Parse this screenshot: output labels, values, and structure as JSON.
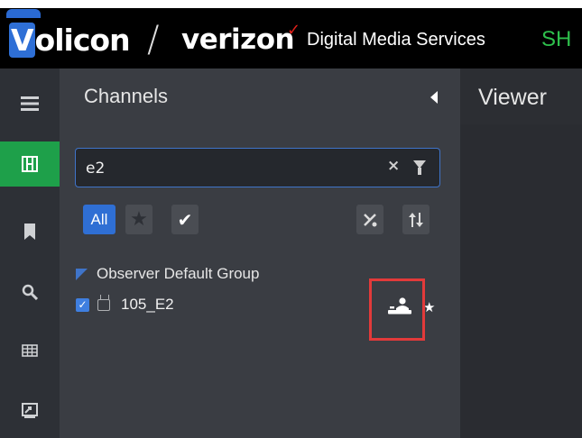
{
  "header": {
    "brand_volicon_first": "V",
    "brand_volicon_rest": "olicon",
    "brand_slash": "/",
    "brand_verizon": "verizon",
    "brand_check": "✓",
    "brand_service": "Digital Media Services",
    "brand_cutoff": "SH"
  },
  "sidebar": {
    "items": [
      {
        "icon": "menu-icon"
      },
      {
        "icon": "channels-grid-icon",
        "active": true
      },
      {
        "icon": "bookmark-icon"
      },
      {
        "icon": "search-icon"
      },
      {
        "icon": "table-icon"
      },
      {
        "icon": "export-icon"
      }
    ]
  },
  "channels_panel": {
    "title": "Channels",
    "search_value": "e2",
    "filters": {
      "all_label": "All"
    },
    "group_name": "Observer Default Group",
    "channels": [
      {
        "name": "105_E2",
        "checked": true
      }
    ]
  },
  "viewer": {
    "title": "Viewer"
  },
  "colors": {
    "accent_blue": "#2f6fd4",
    "active_green": "#1ea04a",
    "highlight_red": "#e23a3a"
  }
}
